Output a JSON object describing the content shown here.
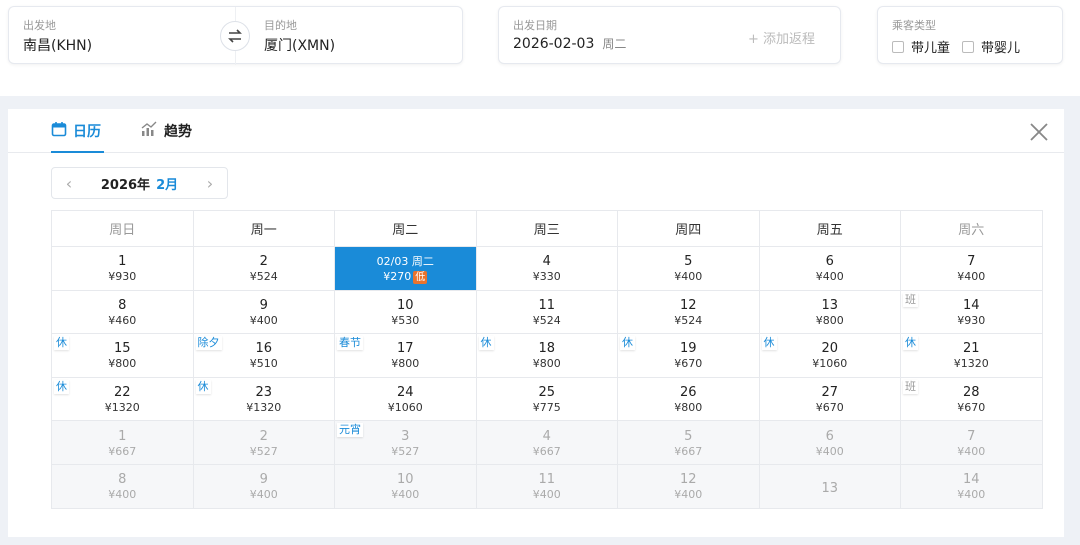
{
  "search": {
    "from_label": "出发地",
    "from_value": "南昌(KHN)",
    "to_label": "目的地",
    "to_value": "厦门(XMN)",
    "date_label": "出发日期",
    "date_value": "2026-02-03",
    "date_weekday": "周二",
    "add_return": "+ 添加返程",
    "passenger_label": "乘客类型",
    "child_label": "带儿童",
    "infant_label": "带婴儿"
  },
  "tabs": [
    {
      "label": "日历",
      "icon": "calendar-icon",
      "active": true
    },
    {
      "label": "趋势",
      "icon": "chart-icon",
      "active": false
    }
  ],
  "month_nav": {
    "year": "2026年",
    "month": "2月"
  },
  "weekdays": [
    "周日",
    "周一",
    "周二",
    "周三",
    "周四",
    "周五",
    "周六"
  ],
  "rows": [
    [
      {
        "day": "1",
        "price": "¥930"
      },
      {
        "day": "2",
        "price": "¥524"
      },
      {
        "day": "02/03 周二",
        "price": "¥270",
        "selected": true,
        "badge": "低"
      },
      {
        "day": "4",
        "price": "¥330"
      },
      {
        "day": "5",
        "price": "¥400"
      },
      {
        "day": "6",
        "price": "¥400"
      },
      {
        "day": "7",
        "price": "¥400"
      }
    ],
    [
      {
        "day": "8",
        "price": "¥460"
      },
      {
        "day": "9",
        "price": "¥400"
      },
      {
        "day": "10",
        "price": "¥530"
      },
      {
        "day": "11",
        "price": "¥524"
      },
      {
        "day": "12",
        "price": "¥524"
      },
      {
        "day": "13",
        "price": "¥800"
      },
      {
        "day": "14",
        "price": "¥930",
        "tag": "班"
      }
    ],
    [
      {
        "day": "15",
        "price": "¥800",
        "tag": "休"
      },
      {
        "day": "16",
        "price": "¥510",
        "tag": "除夕"
      },
      {
        "day": "17",
        "price": "¥800",
        "tag": "春节"
      },
      {
        "day": "18",
        "price": "¥800",
        "tag": "休"
      },
      {
        "day": "19",
        "price": "¥670",
        "tag": "休"
      },
      {
        "day": "20",
        "price": "¥1060",
        "tag": "休"
      },
      {
        "day": "21",
        "price": "¥1320",
        "tag": "休"
      }
    ],
    [
      {
        "day": "22",
        "price": "¥1320",
        "tag": "休"
      },
      {
        "day": "23",
        "price": "¥1320",
        "tag": "休"
      },
      {
        "day": "24",
        "price": "¥1060"
      },
      {
        "day": "25",
        "price": "¥775"
      },
      {
        "day": "26",
        "price": "¥800"
      },
      {
        "day": "27",
        "price": "¥670"
      },
      {
        "day": "28",
        "price": "¥670",
        "tag": "班"
      }
    ],
    [
      {
        "day": "1",
        "price": "¥667",
        "next": true
      },
      {
        "day": "2",
        "price": "¥527",
        "next": true
      },
      {
        "day": "3",
        "price": "¥527",
        "next": true,
        "tag": "元宵"
      },
      {
        "day": "4",
        "price": "¥667",
        "next": true
      },
      {
        "day": "5",
        "price": "¥667",
        "next": true
      },
      {
        "day": "6",
        "price": "¥400",
        "next": true
      },
      {
        "day": "7",
        "price": "¥400",
        "next": true
      }
    ],
    [
      {
        "day": "8",
        "price": "¥400",
        "next": true
      },
      {
        "day": "9",
        "price": "¥400",
        "next": true
      },
      {
        "day": "10",
        "price": "¥400",
        "next": true
      },
      {
        "day": "11",
        "price": "¥400",
        "next": true
      },
      {
        "day": "12",
        "price": "¥400",
        "next": true
      },
      {
        "day": "13",
        "price": "",
        "next": true
      },
      {
        "day": "14",
        "price": "¥400",
        "next": true
      }
    ]
  ],
  "colors": {
    "accent": "#1a8bd8",
    "low_badge": "#e8732e"
  }
}
